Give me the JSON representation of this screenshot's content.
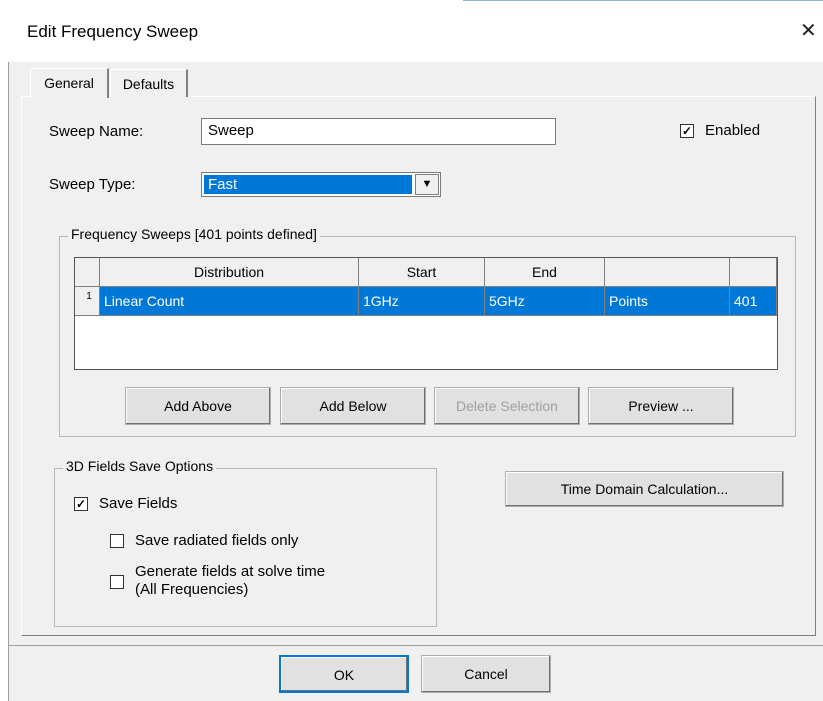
{
  "window": {
    "title": "Edit Frequency Sweep",
    "close_glyph": "✕"
  },
  "tabs": [
    {
      "label": "General"
    },
    {
      "label": "Defaults"
    }
  ],
  "general": {
    "sweep_name_label": "Sweep Name:",
    "sweep_name_value": "Sweep",
    "enabled_label": "Enabled",
    "enabled_checked": true,
    "sweep_type_label": "Sweep Type:",
    "sweep_type_value": "Fast",
    "frequency_group_title": "Frequency Sweeps [401 points defined]",
    "grid": {
      "columns": [
        "Distribution",
        "Start",
        "End",
        "",
        ""
      ],
      "rows": [
        {
          "index": "1",
          "cells": [
            "Linear Count",
            "1GHz",
            "5GHz",
            "Points",
            "401"
          ]
        }
      ]
    },
    "buttons": {
      "add_above": "Add Above",
      "add_below": "Add Below",
      "delete_selection": "Delete Selection",
      "preview": "Preview ..."
    },
    "fields_group_title": "3D Fields Save Options",
    "save_fields_label": "Save Fields",
    "save_fields_checked": true,
    "save_radiated_label": "Save radiated fields only",
    "save_radiated_checked": false,
    "generate_fields_label_line1": "Generate fields at solve time",
    "generate_fields_label_line2": "(All Frequencies)",
    "generate_fields_checked": false,
    "time_domain_button": "Time Domain Calculation..."
  },
  "footer": {
    "ok": "OK",
    "cancel": "Cancel"
  },
  "colors": {
    "selection": "#0078d7",
    "dialog_bg": "#f0f0f0"
  }
}
